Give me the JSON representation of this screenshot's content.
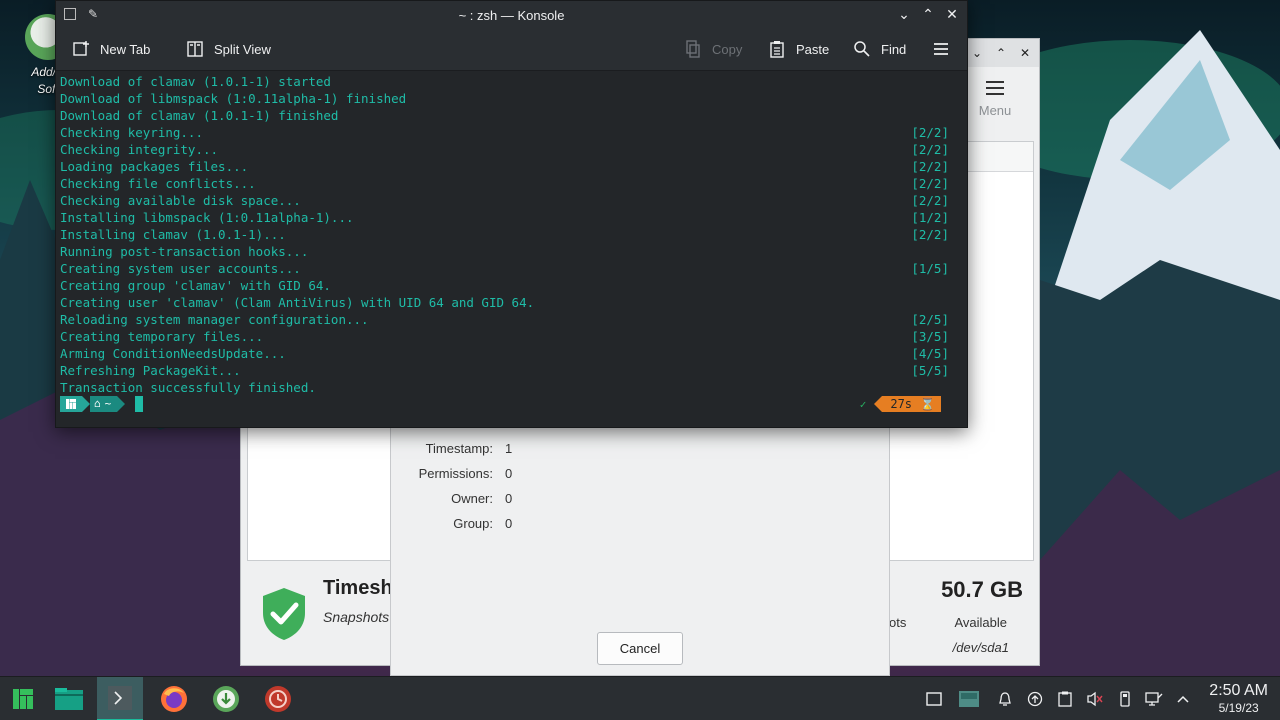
{
  "desktop": {
    "icon_label_line1": "Add/R",
    "icon_label_line2": "Soft"
  },
  "timeshift": {
    "menu_label": "Menu",
    "title": "Timesh",
    "subtitle": "Snapshots",
    "snapshots_partial": "ots",
    "size": "50.7 GB",
    "available_label": "Available",
    "device": "/dev/sda1"
  },
  "dialog": {
    "rows": [
      {
        "label": "Timestamp:",
        "value": "1"
      },
      {
        "label": "Permissions:",
        "value": "0"
      },
      {
        "label": "Owner:",
        "value": "0"
      },
      {
        "label": "Group:",
        "value": "0"
      }
    ],
    "cancel_label": "Cancel"
  },
  "konsole": {
    "title": "~ : zsh — Konsole",
    "toolbar": {
      "new_tab": "New Tab",
      "split_view": "Split View",
      "copy": "Copy",
      "paste": "Paste",
      "find": "Find"
    },
    "lines": [
      {
        "text": "Download of clamav (1.0.1-1) started",
        "status": ""
      },
      {
        "text": "Download of libmspack (1:0.11alpha-1) finished",
        "status": ""
      },
      {
        "text": "Download of clamav (1.0.1-1) finished",
        "status": ""
      },
      {
        "text": "Checking keyring...",
        "status": "[2/2]"
      },
      {
        "text": "Checking integrity...",
        "status": "[2/2]"
      },
      {
        "text": "Loading packages files...",
        "status": "[2/2]"
      },
      {
        "text": "Checking file conflicts...",
        "status": "[2/2]"
      },
      {
        "text": "Checking available disk space...",
        "status": "[2/2]"
      },
      {
        "text": "Installing libmspack (1:0.11alpha-1)...",
        "status": "[1/2]"
      },
      {
        "text": "Installing clamav (1.0.1-1)...",
        "status": "[2/2]"
      },
      {
        "text": "Running post-transaction hooks...",
        "status": ""
      },
      {
        "text": "Creating system user accounts...",
        "status": "[1/5]"
      },
      {
        "text": "Creating group 'clamav' with GID 64.",
        "status": ""
      },
      {
        "text": "Creating user 'clamav' (Clam AntiVirus) with UID 64 and GID 64.",
        "status": ""
      },
      {
        "text": "Reloading system manager configuration...",
        "status": "[2/5]"
      },
      {
        "text": "Creating temporary files...",
        "status": "[3/5]"
      },
      {
        "text": "Arming ConditionNeedsUpdate...",
        "status": "[4/5]"
      },
      {
        "text": "Refreshing PackageKit...",
        "status": "[5/5]"
      },
      {
        "text": "Transaction successfully finished.",
        "status": ""
      }
    ],
    "prompt": {
      "home": "~",
      "check": "✓",
      "elapsed": "27s",
      "hourglass": "⌛"
    }
  },
  "taskbar": {
    "time": "2:50 AM",
    "date": "5/19/23"
  },
  "colors": {
    "terminal_text": "#1fbca7",
    "terminal_bg": "#232629",
    "accent": "#26a599",
    "timer": "#e67e22"
  }
}
